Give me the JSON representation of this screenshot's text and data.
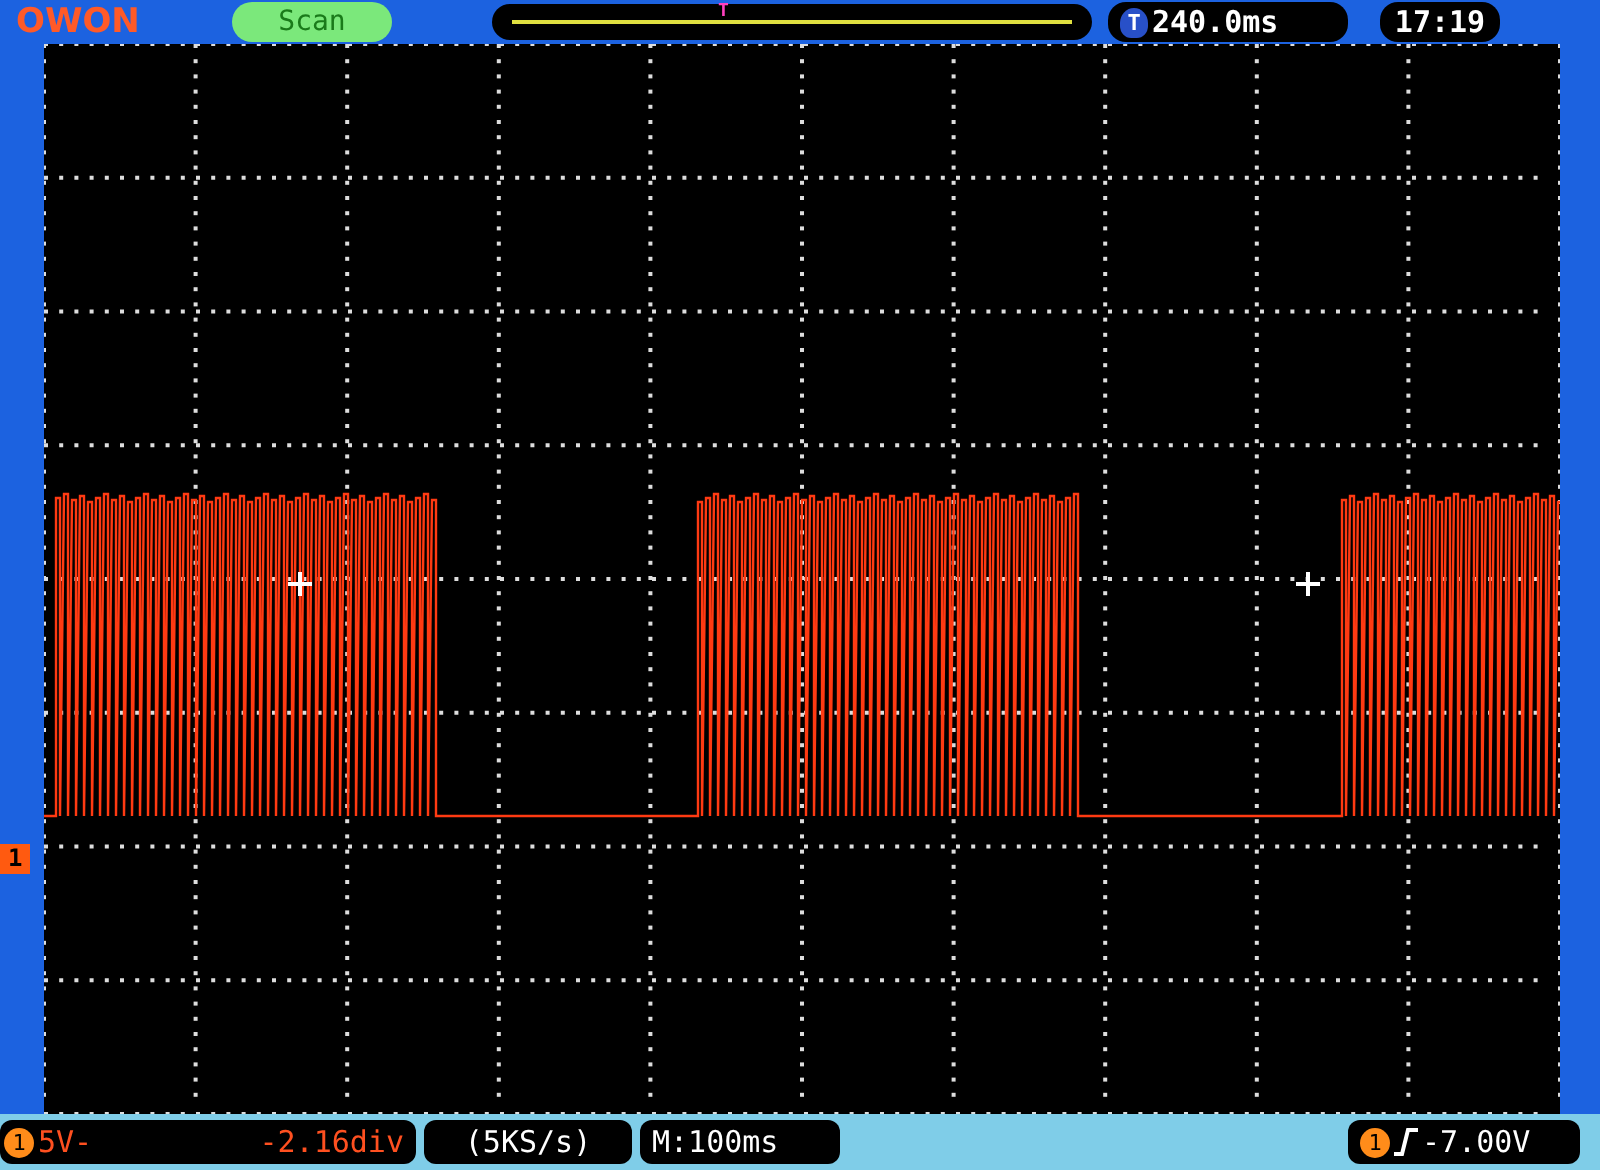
{
  "top_bar": {
    "logo": "OWON",
    "mode": "Scan",
    "trigger_marker": "T",
    "trigger_badge": "T",
    "trigger_delay": "240.0ms",
    "clock": "17:19"
  },
  "channel_marker": "1",
  "bottom_bar": {
    "channel": {
      "badge": "1",
      "scale": "5V-",
      "offset": "-2.16div"
    },
    "sample_rate": "(5KS/s)",
    "timebase": "M:100ms",
    "trigger": {
      "badge": "1",
      "level": "-7.00V"
    }
  }
}
